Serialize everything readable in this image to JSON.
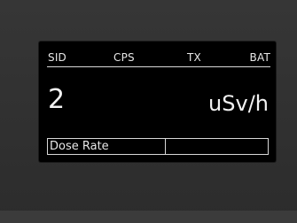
{
  "status": {
    "sid": "SID",
    "cps": "CPS",
    "tx": "TX",
    "bat": "BAT"
  },
  "reading": {
    "value": "2",
    "unit": "uSv/h"
  },
  "mode": {
    "label": "Dose Rate"
  }
}
